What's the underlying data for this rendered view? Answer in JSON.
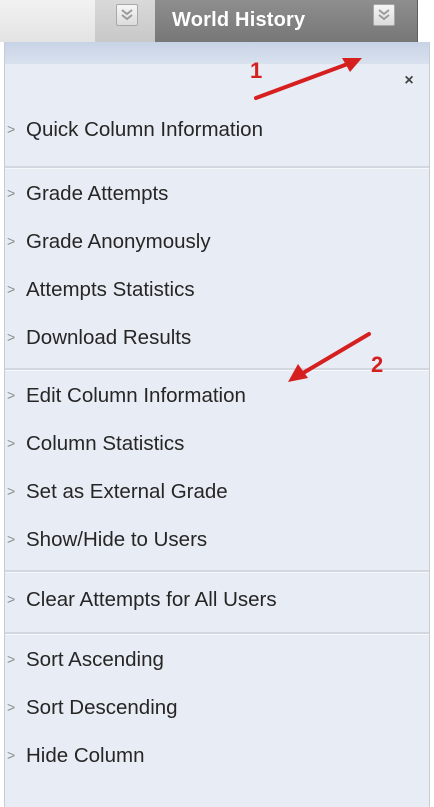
{
  "header": {
    "column_title": "World History"
  },
  "menu": {
    "close_glyph": "×",
    "arrow_glyph": ">",
    "items": [
      {
        "label": "Quick Column Information"
      },
      {
        "label": "Grade Attempts"
      },
      {
        "label": "Grade Anonymously"
      },
      {
        "label": "Attempts Statistics"
      },
      {
        "label": "Download Results"
      },
      {
        "label": "Edit Column Information"
      },
      {
        "label": "Column Statistics"
      },
      {
        "label": "Set as External Grade"
      },
      {
        "label": "Show/Hide to Users"
      },
      {
        "label": "Clear Attempts for All Users"
      },
      {
        "label": "Sort Ascending"
      },
      {
        "label": "Sort Descending"
      },
      {
        "label": "Hide Column"
      }
    ]
  },
  "annotations": {
    "marker_1": "1",
    "marker_2": "2",
    "color": "#d62020"
  },
  "icons": {
    "header_left_button": "chevron-down-icon",
    "header_right_button": "chevron-down-icon",
    "close": "close-icon",
    "menu_item_bullet": "chevron-right-icon"
  },
  "colors": {
    "header_column_bg": "#808080",
    "menu_bg": "#e8ecf4",
    "menu_text": "#262626",
    "annotation_red": "#d62020"
  }
}
